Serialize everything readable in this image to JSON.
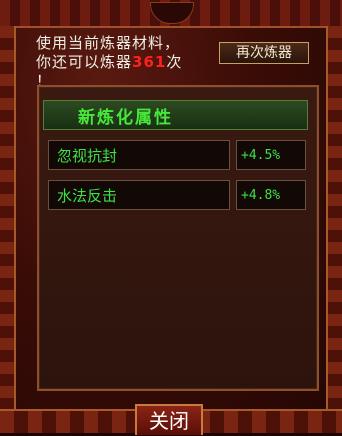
{
  "message": {
    "line1": "使用当前炼器材料，",
    "line2_prefix": "你还可以炼器",
    "count": "361",
    "line2_suffix": "次",
    "line3": "！"
  },
  "buttons": {
    "again": "再次炼器",
    "close": "关闭"
  },
  "panel": {
    "title": "新炼化属性",
    "rows": [
      {
        "name": "忽视抗封",
        "value": "+4.5%"
      },
      {
        "name": "水法反击",
        "value": "+4.8%"
      }
    ]
  },
  "colors": {
    "accent_green": "#3ee046",
    "count_red": "#ff2020"
  }
}
